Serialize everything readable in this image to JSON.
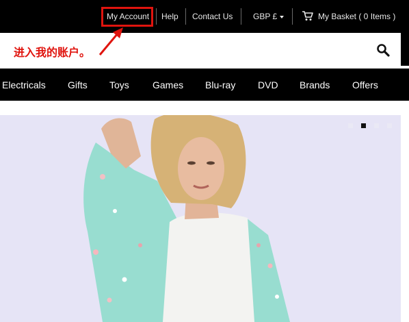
{
  "header": {
    "my_account": "My Account",
    "help": "Help",
    "contact_us": "Contact Us",
    "currency": "GBP £",
    "basket": "My Basket ( 0 Items )"
  },
  "annotation": {
    "text": "进入我的账户。",
    "color": "#e0140e"
  },
  "search": {
    "placeholder": ""
  },
  "nav": {
    "items": [
      "Electricals",
      "Gifts",
      "Toys",
      "Games",
      "Blu-ray",
      "DVD",
      "Brands",
      "Offers"
    ]
  },
  "hero": {
    "background": "#e6e4f6",
    "slide_count": 4,
    "active_slide": 2
  },
  "icons": {
    "cart": "cart-icon",
    "search": "search-icon",
    "currency_caret": "caret-down-icon"
  }
}
